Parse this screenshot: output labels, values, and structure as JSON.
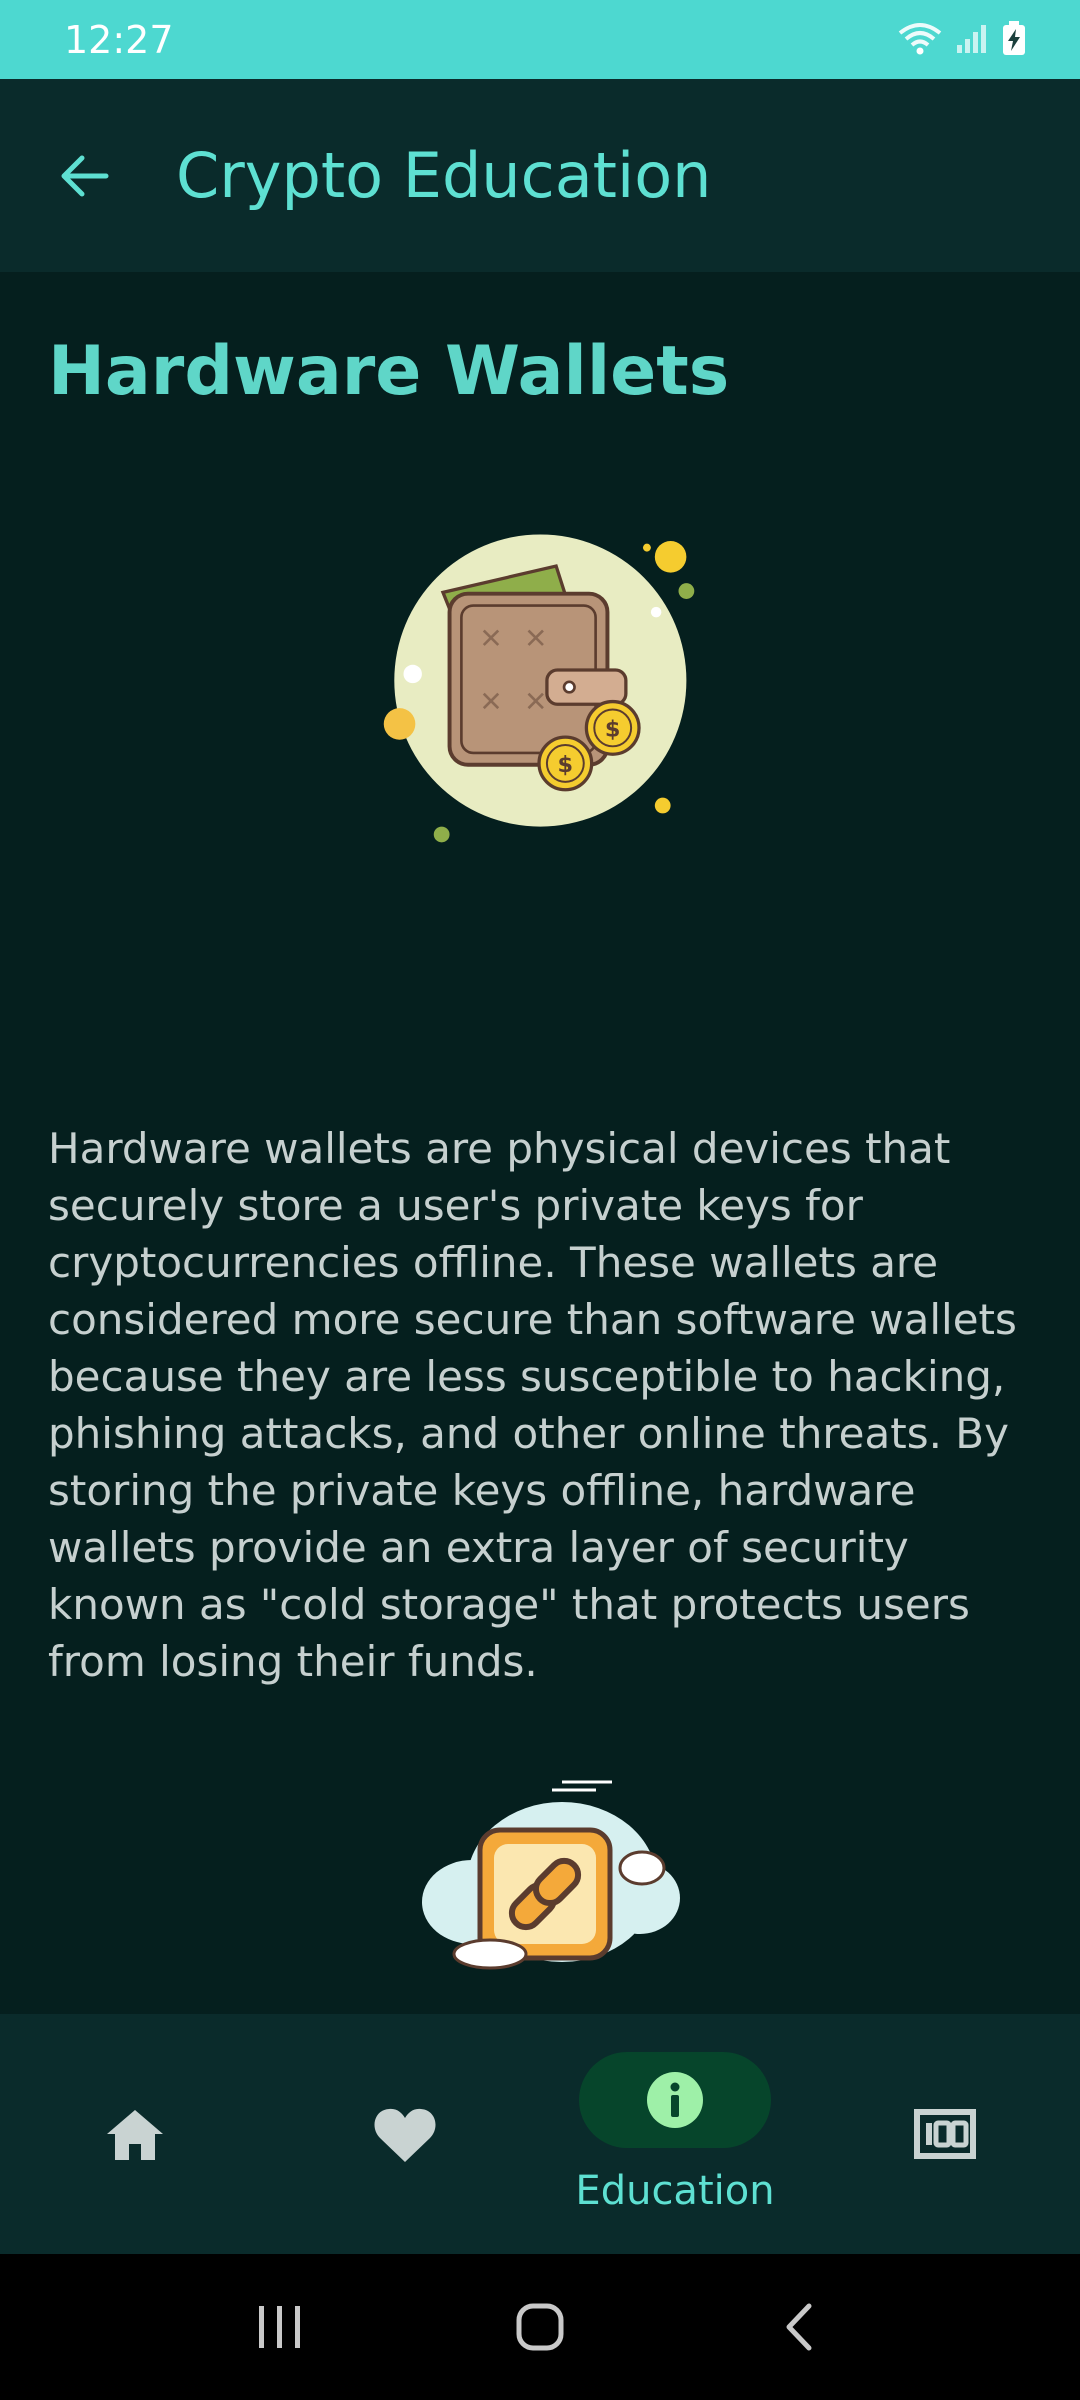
{
  "status_bar": {
    "time": "12:27",
    "icons": [
      "wifi-icon",
      "signal-icon",
      "battery-charging-icon"
    ]
  },
  "app_bar": {
    "title": "Crypto Education",
    "back_icon": "arrow-left-icon"
  },
  "article": {
    "title": "Hardware Wallets",
    "illustration": "wallet-with-coins-illustration",
    "body": "Hardware wallets are physical devices that securely store a user's private keys for cryptocurrencies offline. These wallets are considered more secure than software wallets because they are less susceptible to hacking, phishing attacks, and other online threats. By storing the private keys offline, hardware wallets provide an extra layer of security known as \"cold storage\" that protects users from losing their funds.",
    "second_illustration": "cloud-chain-link-illustration"
  },
  "bottom_nav": {
    "items": [
      {
        "icon": "home-icon",
        "label": "",
        "active": false
      },
      {
        "icon": "heart-icon",
        "label": "",
        "active": false
      },
      {
        "icon": "info-icon",
        "label": "Education",
        "active": true
      },
      {
        "icon": "counter-100-icon",
        "label": "",
        "active": false
      }
    ],
    "active_color": "#5ee0d2",
    "pill_color": "#06452b",
    "inactive_color": "#c9d3d2"
  },
  "colors": {
    "status_bar": "#4dd8d0",
    "app_bar": "#0a2b2b",
    "background": "#051f1e",
    "accent": "#5fd6c8",
    "body_text": "#c6d0cf"
  }
}
